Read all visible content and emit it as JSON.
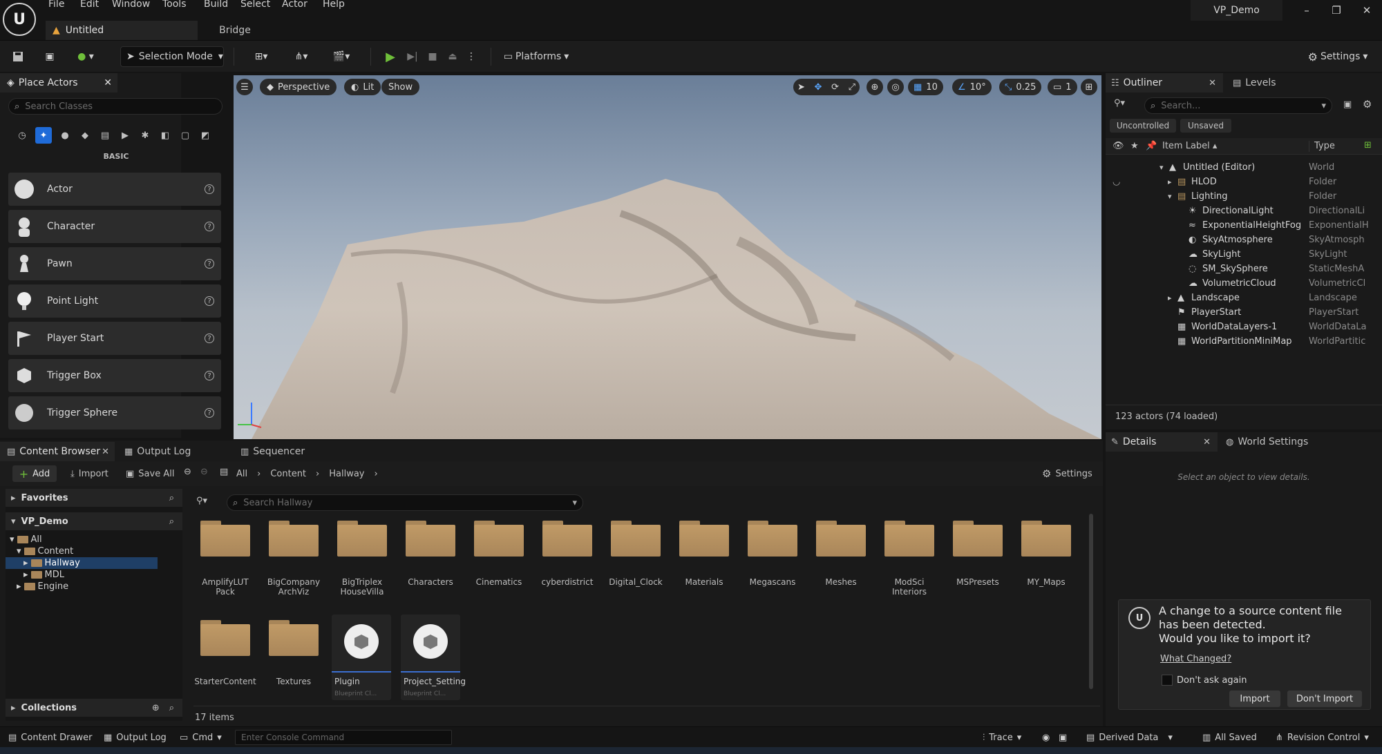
{
  "menubar": {
    "items": [
      "File",
      "Edit",
      "Window",
      "Tools",
      "Build",
      "Select",
      "Actor",
      "Help"
    ],
    "project": "VP_Demo"
  },
  "tabs": {
    "level": "Untitled",
    "bridge": "Bridge"
  },
  "toolbar": {
    "mode": "Selection Mode",
    "platforms": "Platforms",
    "settings": "Settings"
  },
  "place": {
    "title": "Place Actors",
    "search_placeholder": "Search Classes",
    "category": "BASIC",
    "items": [
      "Actor",
      "Character",
      "Pawn",
      "Point Light",
      "Player Start",
      "Trigger Box",
      "Trigger Sphere"
    ]
  },
  "viewport": {
    "perspective": "Perspective",
    "lit": "Lit",
    "show": "Show",
    "grid": "10",
    "angle": "10°",
    "scale": "0.25",
    "camera": "1"
  },
  "outliner": {
    "tab": "Outliner",
    "levels": "Levels",
    "search_placeholder": "Search...",
    "uncontrolled": "Uncontrolled",
    "unsaved": "Unsaved",
    "col_label": "Item Label",
    "col_type": "Type",
    "rows": [
      {
        "label": "Untitled (Editor)",
        "type": "World"
      },
      {
        "label": "HLOD",
        "type": "Folder"
      },
      {
        "label": "Lighting",
        "type": "Folder"
      },
      {
        "label": "DirectionalLight",
        "type": "DirectionalLi"
      },
      {
        "label": "ExponentialHeightFog",
        "type": "ExponentialH"
      },
      {
        "label": "SkyAtmosphere",
        "type": "SkyAtmosph"
      },
      {
        "label": "SkyLight",
        "type": "SkyLight"
      },
      {
        "label": "SM_SkySphere",
        "type": "StaticMeshA"
      },
      {
        "label": "VolumetricCloud",
        "type": "VolumetricCl"
      },
      {
        "label": "Landscape",
        "type": "Landscape"
      },
      {
        "label": "PlayerStart",
        "type": "PlayerStart"
      },
      {
        "label": "WorldDataLayers-1",
        "type": "WorldDataLa"
      },
      {
        "label": "WorldPartitionMiniMap",
        "type": "WorldPartitic"
      }
    ],
    "footer": "123 actors (74 loaded)"
  },
  "cb": {
    "tab": "Content Browser",
    "output_log": "Output Log",
    "sequencer": "Sequencer",
    "add": "Add",
    "import": "Import",
    "save_all": "Save All",
    "crumbs": [
      "All",
      "Content",
      "Hallway"
    ],
    "settings": "Settings",
    "favorites": "Favorites",
    "root": "VP_Demo",
    "tree": [
      "All",
      "Content",
      "Hallway",
      "MDL",
      "Engine"
    ],
    "search_placeholder": "Search Hallway",
    "folders": [
      "AmplifyLUT Pack",
      "BigCompany ArchViz",
      "BigTriplex HouseVilla",
      "Characters",
      "Cinematics",
      "cyberdistrict",
      "Digital_Clock",
      "Materials",
      "Megascans",
      "Meshes",
      "ModSci Interiors",
      "MSPresets",
      "MY_Maps",
      "StarterContent",
      "Textures"
    ],
    "assets": [
      {
        "name": "Plugin",
        "kind": "Blueprint Cl..."
      },
      {
        "name": "Project_Setting",
        "kind": "Blueprint Cl..."
      }
    ],
    "collections": "Collections",
    "count": "17 items"
  },
  "details": {
    "tab": "Details",
    "world": "World Settings",
    "hint": "Select an object to view details."
  },
  "notif": {
    "title": "A change to a source content file has been detected.",
    "question": "Would you like to import it?",
    "link": "What Changed?",
    "checkbox": "Don't ask again",
    "import": "Import",
    "dont": "Don't Import"
  },
  "status": {
    "drawer": "Content Drawer",
    "output": "Output Log",
    "cmd": "Cmd",
    "console_placeholder": "Enter Console Command",
    "trace": "Trace",
    "derived": "Derived Data",
    "saved": "All Saved",
    "revision": "Revision Control"
  }
}
